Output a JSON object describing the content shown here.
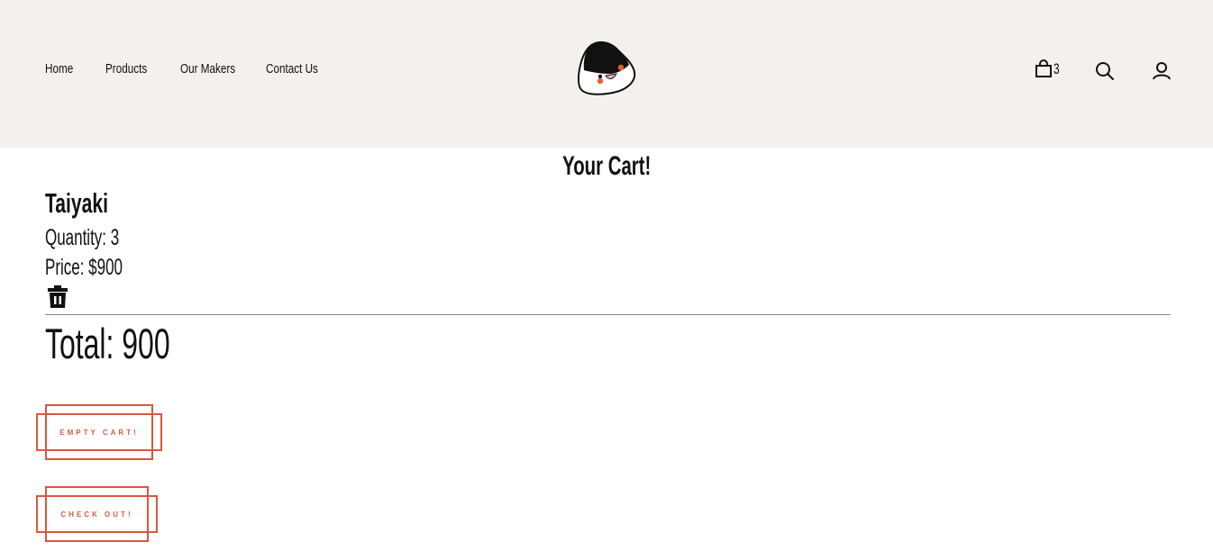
{
  "colors": {
    "header_bg": "#f4f1ec",
    "accent": "#d9583f",
    "text": "#111111"
  },
  "nav": {
    "home": "Home",
    "products": "Products",
    "makers": "Our Makers",
    "contact": "Contact Us"
  },
  "header": {
    "cart_count": "3",
    "icons": [
      "onigiri-logo-icon",
      "shopping-bag-icon",
      "search-icon",
      "user-icon"
    ]
  },
  "cart": {
    "title": "Your Cart!",
    "items": [
      {
        "name": "Taiyaki",
        "quantity": "Quantity: 3",
        "price": "Price: $900"
      }
    ],
    "total": "Total: 900",
    "empty_button": "EMPTY CART!",
    "checkout_button": "CHECK OUT!"
  }
}
